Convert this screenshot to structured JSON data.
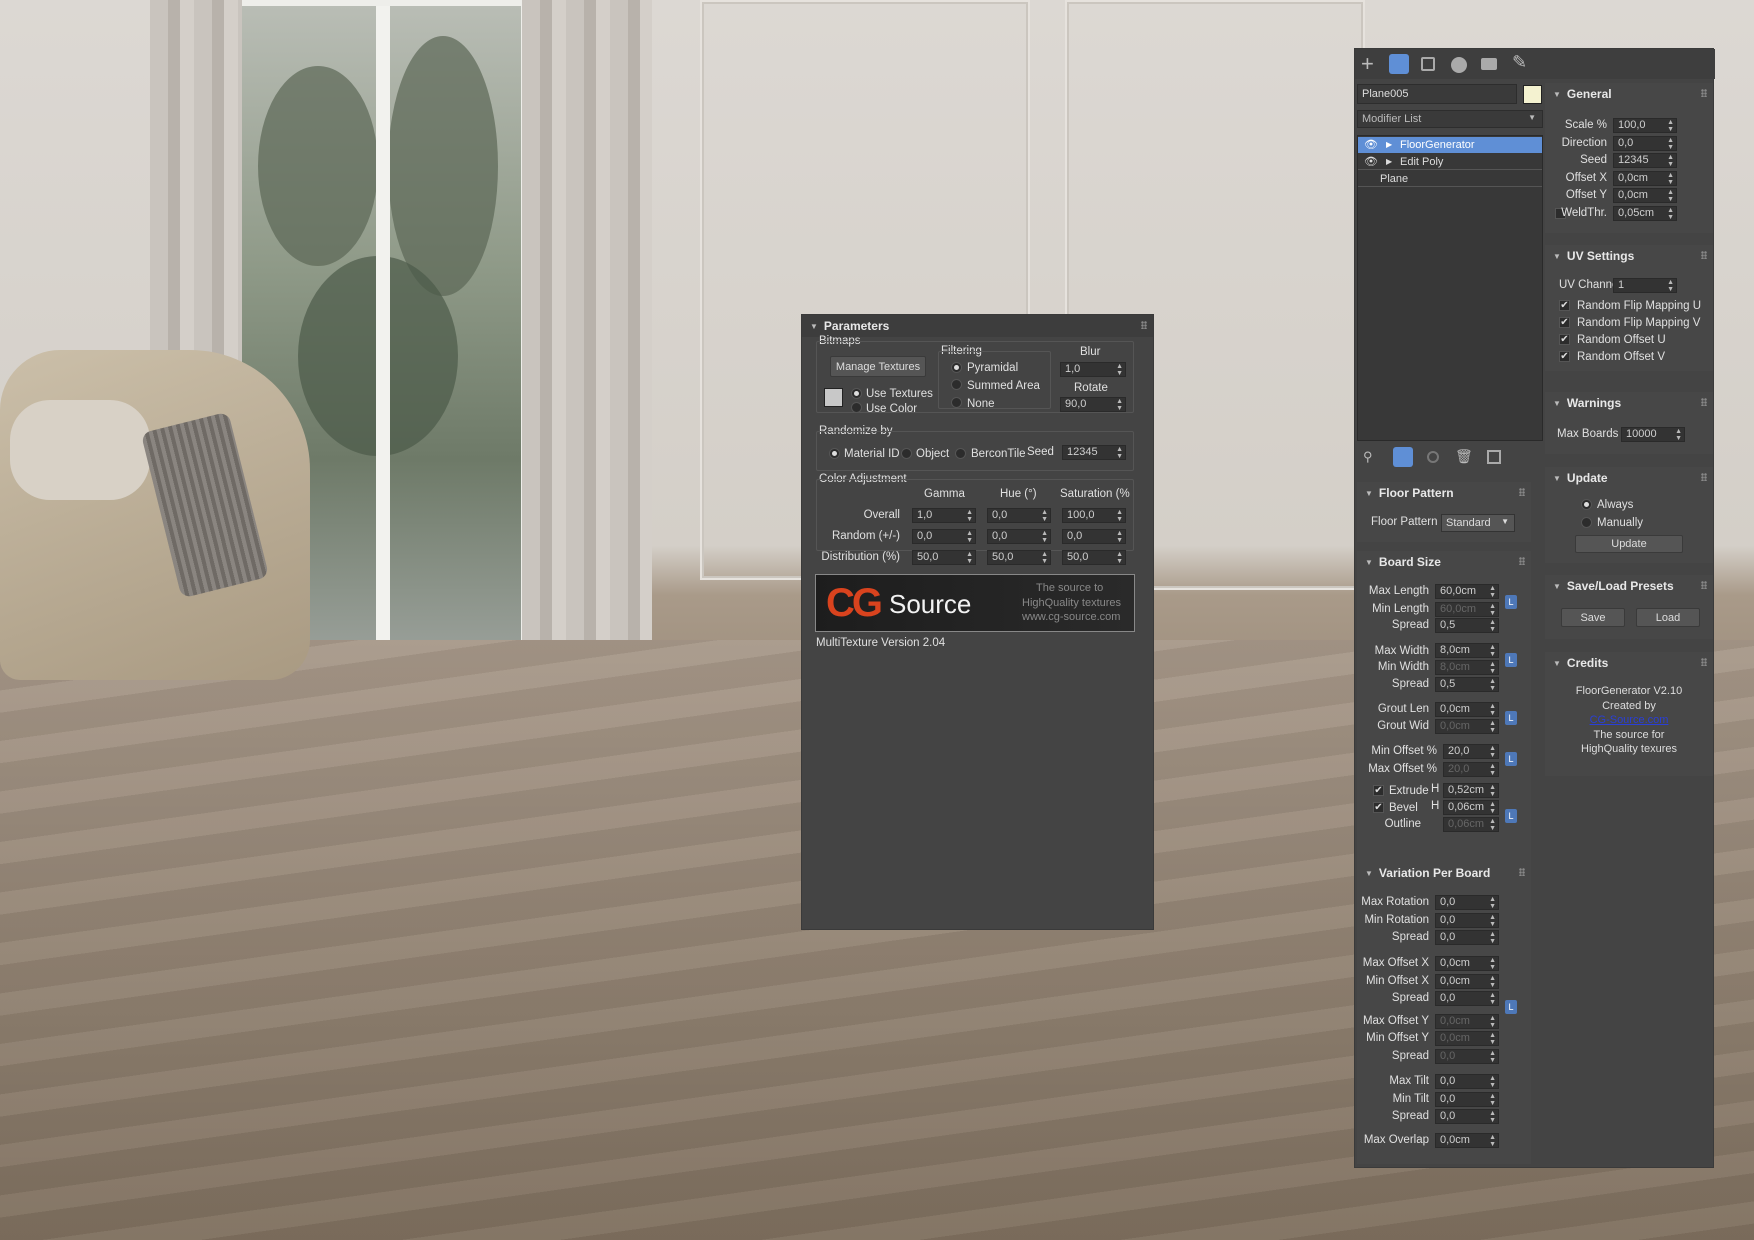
{
  "colors": {
    "panel": "#444444",
    "accent": "#5f8fd6",
    "field": "#333333",
    "object_color": "#f4f2d0"
  },
  "mt": {
    "title": "Parameters",
    "bitmaps": {
      "group": "Bitmaps",
      "manage": "Manage Textures",
      "use_textures": "Use Textures",
      "use_color": "Use Color"
    },
    "filtering": {
      "group": "Filtering",
      "pyramidal": "Pyramidal",
      "summed": "Summed Area",
      "none": "None"
    },
    "blur": {
      "label": "Blur",
      "value": "1,0"
    },
    "rotate": {
      "label": "Rotate",
      "value": "90,0"
    },
    "randomize": {
      "group": "Randomize by",
      "material": "Material ID",
      "object": "Object",
      "bercon": "BerconTile",
      "seed_label": "Seed",
      "seed": "12345"
    },
    "color": {
      "group": "Color Adjustment",
      "gamma": "Gamma",
      "hue": "Hue (°)",
      "sat": "Saturation (%",
      "rows": [
        {
          "label": "Overall",
          "g": "1,0",
          "h": "0,0",
          "s": "100,0"
        },
        {
          "label": "Random (+/-)",
          "g": "0,0",
          "h": "0,0",
          "s": "0,0"
        },
        {
          "label": "Distribution (%)",
          "g": "50,0",
          "h": "50,0",
          "s": "50,0"
        }
      ]
    },
    "logo": {
      "cg": "CG",
      "source": "Source",
      "tag1": "The source to",
      "tag2": "HighQuality textures",
      "tag3": "www.cg-source.com"
    },
    "version": "MultiTexture Version 2.04"
  },
  "cmd": {
    "object_name": "Plane005",
    "modifier_list": "Modifier List",
    "stack": [
      "FloorGenerator",
      "Edit Poly",
      "Plane"
    ],
    "floor_pattern": {
      "title": "Floor Pattern",
      "label": "Floor Pattern",
      "value": "Standard"
    },
    "board": {
      "title": "Board Size",
      "max_length": {
        "label": "Max Length",
        "value": "60,0cm"
      },
      "min_length": {
        "label": "Min Length",
        "value": "60,0cm"
      },
      "spread1": {
        "label": "Spread",
        "value": "0,5"
      },
      "max_width": {
        "label": "Max Width",
        "value": "8,0cm"
      },
      "min_width": {
        "label": "Min Width",
        "value": "8,0cm"
      },
      "spread2": {
        "label": "Spread",
        "value": "0,5"
      },
      "grout_len": {
        "label": "Grout Len",
        "value": "0,0cm"
      },
      "grout_wid": {
        "label": "Grout Wid",
        "value": "0,0cm"
      },
      "min_off": {
        "label": "Min Offset %",
        "value": "20,0"
      },
      "max_off": {
        "label": "Max Offset %",
        "value": "20,0"
      },
      "extrude": {
        "label": "Extrude",
        "h": "H",
        "value": "0,52cm"
      },
      "bevel": {
        "label": "Bevel",
        "h": "H",
        "value": "0,06cm"
      },
      "outline": {
        "label": "Outline",
        "value": "0,06cm"
      },
      "lock": "L"
    },
    "variation": {
      "title": "Variation Per Board",
      "rows": [
        {
          "label": "Max Rotation",
          "value": "0,0"
        },
        {
          "label": "Min Rotation",
          "value": "0,0"
        },
        {
          "label": "Spread",
          "value": "0,0"
        },
        {
          "label": "Max Offset X",
          "value": "0,0cm"
        },
        {
          "label": "Min Offset X",
          "value": "0,0cm"
        },
        {
          "label": "Spread",
          "value": "0,0"
        },
        {
          "label": "Max Offset Y",
          "value": "0,0cm"
        },
        {
          "label": "Min Offset Y",
          "value": "0,0cm"
        },
        {
          "label": "Spread",
          "value": "0,0"
        },
        {
          "label": "Max Tilt",
          "value": "0,0"
        },
        {
          "label": "Min Tilt",
          "value": "0,0"
        },
        {
          "label": "Spread",
          "value": "0,0"
        },
        {
          "label": "Max Overlap",
          "value": "0,0cm"
        }
      ]
    },
    "general": {
      "title": "General",
      "rows": [
        {
          "label": "Scale %",
          "value": "100,0"
        },
        {
          "label": "Direction",
          "value": "0,0"
        },
        {
          "label": "Seed",
          "value": "12345"
        },
        {
          "label": "Offset X",
          "value": "0,0cm"
        },
        {
          "label": "Offset Y",
          "value": "0,0cm"
        },
        {
          "label": "WeldThr.",
          "value": "0,05cm"
        }
      ]
    },
    "uv": {
      "title": "UV Settings",
      "channel_label": "UV Channel",
      "channel": "1",
      "checks": [
        "Random Flip Mapping U",
        "Random Flip Mapping V",
        "Random Offset U",
        "Random Offset V"
      ]
    },
    "warnings": {
      "title": "Warnings",
      "label": "Max Boards",
      "value": "10000"
    },
    "update": {
      "title": "Update",
      "always": "Always",
      "manually": "Manually",
      "button": "Update"
    },
    "presets": {
      "title": "Save/Load Presets",
      "save": "Save",
      "load": "Load"
    },
    "credits": {
      "title": "Credits",
      "l1": "FloorGenerator V2.10",
      "l2": "Created by",
      "l3": "CG-Source.com",
      "l4": "The source for",
      "l5": "HighQuality texures"
    }
  }
}
